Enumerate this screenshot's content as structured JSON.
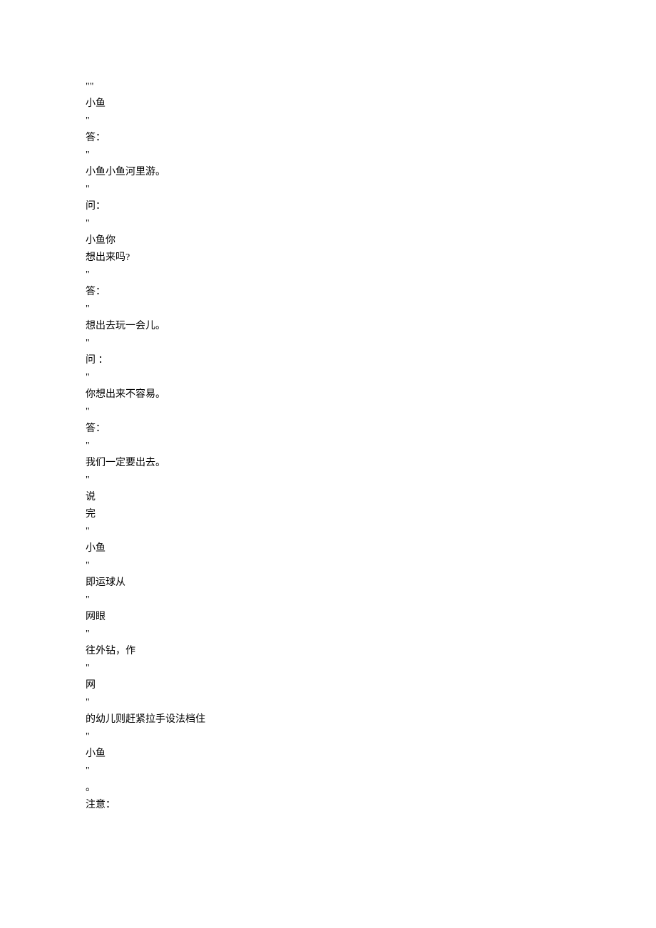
{
  "lines": [
    "\"\"",
    "小鱼",
    "\"",
    "答：",
    "\"",
    "小鱼小鱼河里游。",
    "\"",
    "问：",
    "\"",
    "小鱼你",
    "想出来吗?",
    "\"",
    "答：",
    "\"",
    "想出去玩一会儿。",
    "\"",
    "问 ：",
    "\"",
    "你想出来不容易。",
    "\"",
    "答：",
    "\"",
    "我们一定要出去。",
    "\"",
    "说",
    "完",
    "\"",
    "小鱼",
    "\"",
    "即运球从",
    "\"",
    "网眼",
    "\"",
    "往外钻，作",
    "\"",
    "网",
    "\"",
    "的幼儿则赶紧拉手设法档住",
    "\"",
    "小鱼",
    "\"",
    "。",
    "",
    "注意："
  ]
}
